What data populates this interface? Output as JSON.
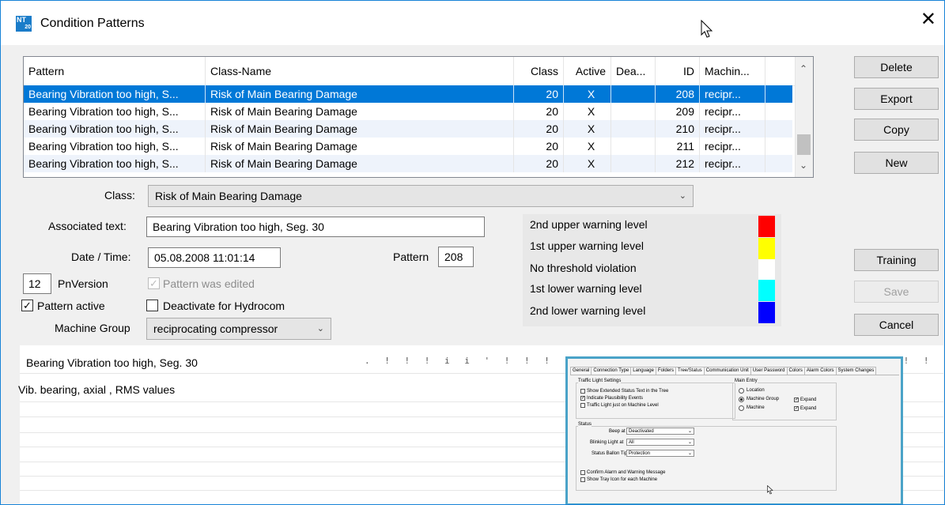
{
  "window": {
    "title": "Condition Patterns",
    "app_badge_top": "NT",
    "app_badge_bottom": "20",
    "close": "✕"
  },
  "table": {
    "columns": [
      "Pattern",
      "Class-Name",
      "Class",
      "Active",
      "Dea...",
      "ID",
      "Machin..."
    ],
    "rows": [
      [
        "Bearing Vibration too high, S...",
        "Risk of Main Bearing Damage",
        "20",
        "X",
        "",
        "208",
        "recipr..."
      ],
      [
        "Bearing Vibration too high, S...",
        "Risk of Main Bearing Damage",
        "20",
        "X",
        "",
        "209",
        "recipr..."
      ],
      [
        "Bearing Vibration too high, S...",
        "Risk of Main Bearing Damage",
        "20",
        "X",
        "",
        "210",
        "recipr..."
      ],
      [
        "Bearing Vibration too high, S...",
        "Risk of Main Bearing Damage",
        "20",
        "X",
        "",
        "211",
        "recipr..."
      ],
      [
        "Bearing Vibration too high, S...",
        "Risk of Main Bearing Damage",
        "20",
        "X",
        "",
        "212",
        "recipr..."
      ]
    ],
    "selected_row": 0
  },
  "buttons": {
    "delete": "Delete",
    "export": "Export",
    "copy": "Copy",
    "new": "New",
    "training": "Training",
    "save": "Save",
    "cancel": "Cancel"
  },
  "form": {
    "class_label": "Class:",
    "class_value": "Risk of Main Bearing Damage",
    "assoc_label": "Associated text:",
    "assoc_value": "Bearing Vibration too high, Seg. 30",
    "date_label": "Date / Time:",
    "date_value": "05.08.2008 11:01:14",
    "pattern_label": "Pattern",
    "pattern_value": "208",
    "pnversion_value": "12",
    "pnversion_label": "PnVersion",
    "edited_label": "Pattern was edited",
    "active_label": "Pattern active",
    "deactivate_label": "Deactivate for Hydrocom",
    "group_label": "Machine Group",
    "group_value": "reciprocating compressor"
  },
  "legend": [
    {
      "text": "2nd upper warning level",
      "color": "#ff0000"
    },
    {
      "text": "1st upper warning level",
      "color": "#ffff00"
    },
    {
      "text": "No threshold violation",
      "color": "#ffffff"
    },
    {
      "text": "1st lower warning level",
      "color": "#00ffff"
    },
    {
      "text": "2nd lower warning level",
      "color": "#0000ff"
    }
  ],
  "textlist": {
    "line1": "Bearing Vibration too high, Seg. 30",
    "line2": "Vib. bearing, axial , RMS values"
  },
  "embedded": {
    "tabs": [
      "General",
      "Connection Type",
      "Language",
      "Folders",
      "Tree/Status",
      "Communication Unit",
      "User Password",
      "Colors",
      "Alarm Colors",
      "System Changes"
    ],
    "active_tab": "Tree/Status",
    "traffic_title": "Traffic Light Settings",
    "opt1": "Show Extended Status Text in the Tree",
    "opt2": "Indicate Plausibility Events",
    "opt3": "Traffic Light just on Machine Level",
    "main_title": "Main Entry",
    "location": "Location",
    "machine_group": "Machine Group",
    "machine": "Machine",
    "expand": "Expand",
    "status_title": "Status",
    "beep_label": "Beep at",
    "beep_value": "Deactivated",
    "blink_label": "Blinking Light at",
    "blink_value": "All",
    "balloon_label": "Status Ballon Tip",
    "balloon_value": "Protection",
    "confirm": "Confirm Alarm and Warning Message",
    "tray": "Show Tray Icon for each Machine"
  }
}
